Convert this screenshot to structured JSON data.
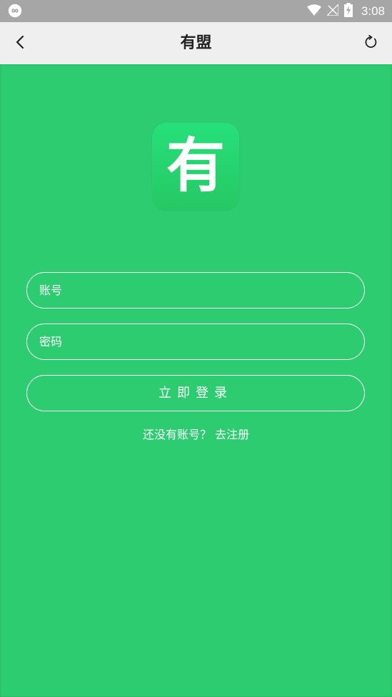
{
  "status_bar": {
    "time": "3:08",
    "icons": [
      "app-notification-icon",
      "wifi-icon",
      "no-signal-icon",
      "battery-charging-icon"
    ]
  },
  "header": {
    "title": "有盟",
    "back_icon": "chevron-left-icon",
    "refresh_icon": "refresh-icon"
  },
  "logo": {
    "text": "有"
  },
  "form": {
    "account_placeholder": "账号",
    "password_placeholder": "密码",
    "login_label": "立即登录"
  },
  "register": {
    "prompt": "还没有账号？",
    "link": "去注册"
  },
  "colors": {
    "background": "#2ecc71",
    "header": "#efefef",
    "status_bar": "#a6a6a6"
  }
}
